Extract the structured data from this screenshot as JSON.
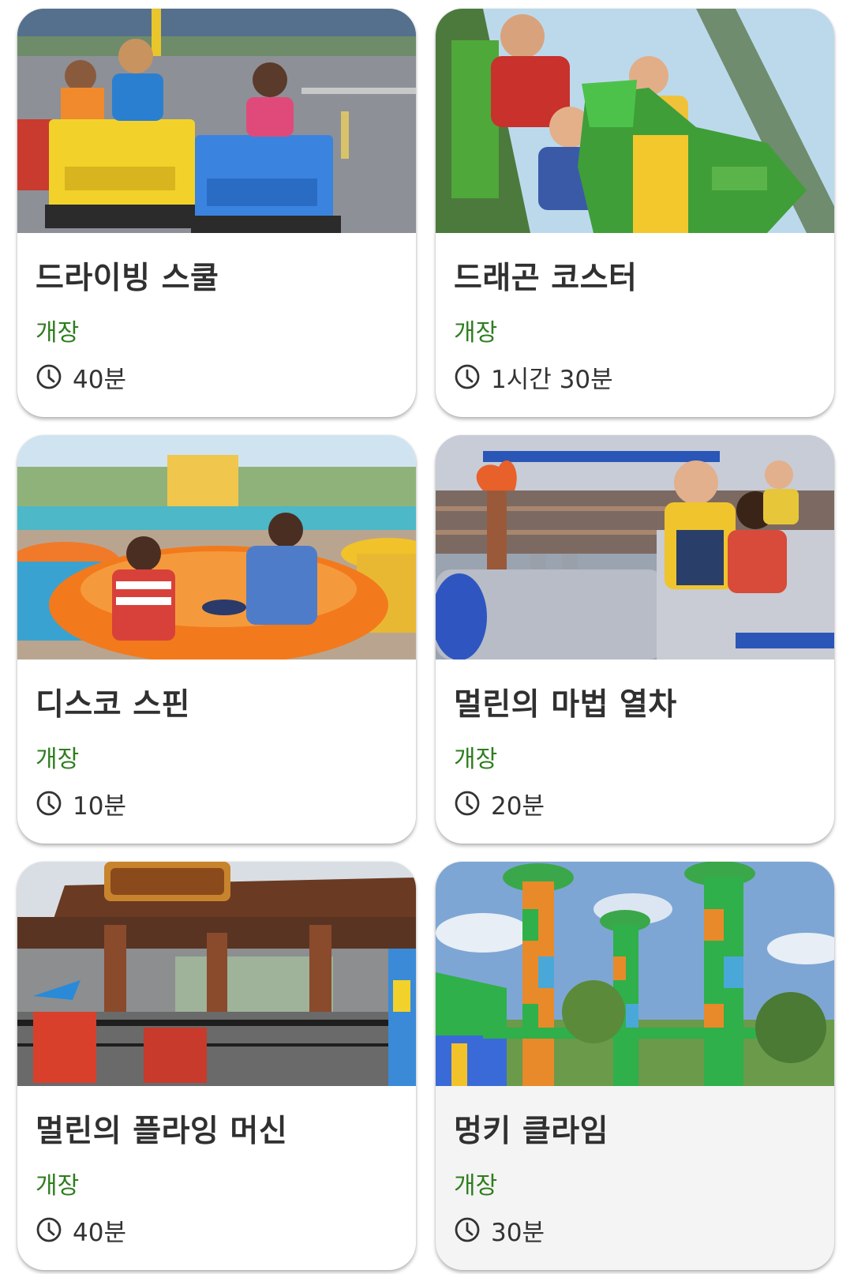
{
  "colors": {
    "status_open": "#2e7d1e",
    "title_text": "#303030",
    "card_background": "#ffffff"
  },
  "icons": {
    "wait_time": "clock-icon"
  },
  "attractions": [
    {
      "name": "드라이빙 스쿨",
      "status": "개장",
      "wait_time": "40분",
      "photo": "kids-driving-lego-cars"
    },
    {
      "name": "드래곤 코스터",
      "status": "개장",
      "wait_time": "1시간 30분",
      "photo": "family-on-green-dragon-coaster"
    },
    {
      "name": "디스코 스핀",
      "status": "개장",
      "wait_time": "10분",
      "photo": "mother-and-girl-in-orange-spinning-cup"
    },
    {
      "name": "멀린의 마법 열차",
      "status": "개장",
      "wait_time": "20분",
      "photo": "children-on-castle-train"
    },
    {
      "name": "멀린의 플라잉 머신",
      "status": "개장",
      "wait_time": "40분",
      "photo": "wooden-pavilion-ride-entrance"
    },
    {
      "name": "멍키 클라임",
      "status": "개장",
      "wait_time": "30분",
      "photo": "colorful-brick-climbing-towers"
    }
  ]
}
